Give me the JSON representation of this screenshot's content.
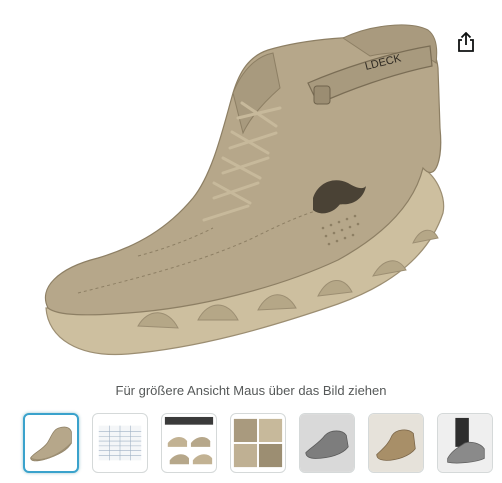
{
  "product_image": {
    "brand_label": "LDECK"
  },
  "share_button": {
    "icon": "share-icon"
  },
  "hover_hint": "Für größere Ansicht Maus über das Bild ziehen",
  "thumbnails": [
    {
      "icon": "shoe-thumbnail",
      "selected": true
    },
    {
      "icon": "size-chart-thumbnail"
    },
    {
      "icon": "product-views-thumbnail"
    },
    {
      "icon": "detail-collage-thumbnail"
    },
    {
      "icon": "grey-shoe-thumbnail"
    },
    {
      "icon": "khaki-shoe-thumbnail"
    },
    {
      "icon": "worn-shoe-thumbnail"
    }
  ],
  "colors": {
    "selected_border": "#3aa2cc",
    "suede": "#b6a78a",
    "sole": "#cdbf9f"
  }
}
